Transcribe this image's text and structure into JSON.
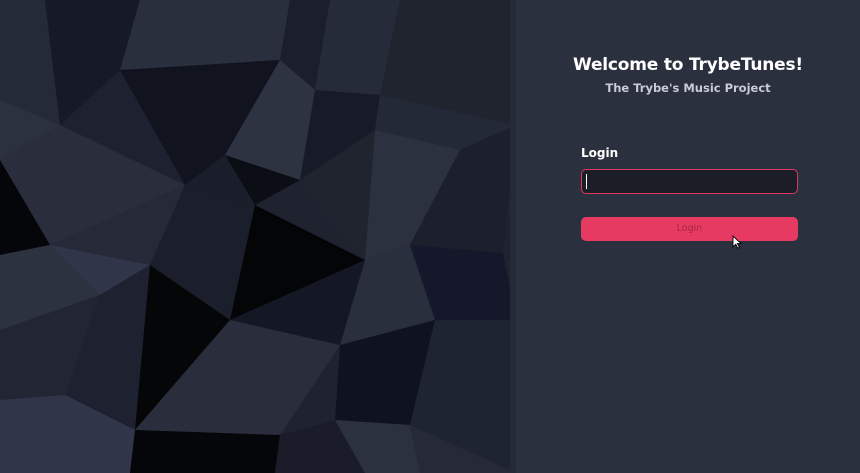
{
  "header": {
    "title": "Welcome to TrybeTunes!",
    "subtitle": "The Trybe's Music Project"
  },
  "form": {
    "login_label": "Login",
    "login_value": "",
    "submit_label": "Login"
  },
  "colors": {
    "accent": "#e63a62",
    "panel_bg": "#2b303e",
    "input_bg": "#1b1d27"
  },
  "icons": {
    "cursor": "mouse-pointer-icon"
  }
}
